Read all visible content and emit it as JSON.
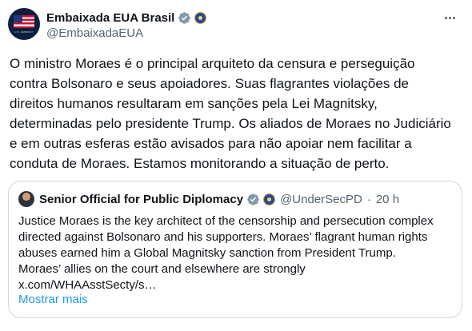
{
  "colors": {
    "verified_badge": "#829aab",
    "link": "#1d9bf0",
    "secondary_text": "#536471",
    "border": "#cfd9de"
  },
  "tweet": {
    "avatar_icon": "us-embassy-flag-avatar",
    "display_name": "Embaixada EUA Brasil",
    "handle": "@EmbaixadaEUA",
    "text_lines": [
      "O ministro Moraes é o principal arquiteto da censura e perseguição",
      "contra Bolsonaro e seus apoiadores. Suas flagrantes violações de",
      "direitos humanos resultaram em sanções pela Lei Magnitsky,",
      "determinadas pelo presidente Trump. Os aliados de Moraes no Judiciário",
      "e em outras esferas estão avisados para não apoiar nem facilitar a",
      "conduta de Moraes. Estamos monitorando a situação de perto."
    ]
  },
  "quote": {
    "display_name": "Senior Official for Public Diplomacy",
    "handle": "@UnderSecPD",
    "separator": "·",
    "time": "20 h",
    "text_lines": [
      "Justice Moraes is the key architect of the censorship and persecution complex",
      "directed against Bolsonaro and his supporters. Moraes’ flagrant human rights",
      "abuses earned him a Global Magnitsky sanction from President Trump.",
      "Moraes’ allies on the court and elsewhere are strongly",
      "x.com/WHAAsstSecty/s…"
    ],
    "show_more": "Mostrar mais"
  }
}
